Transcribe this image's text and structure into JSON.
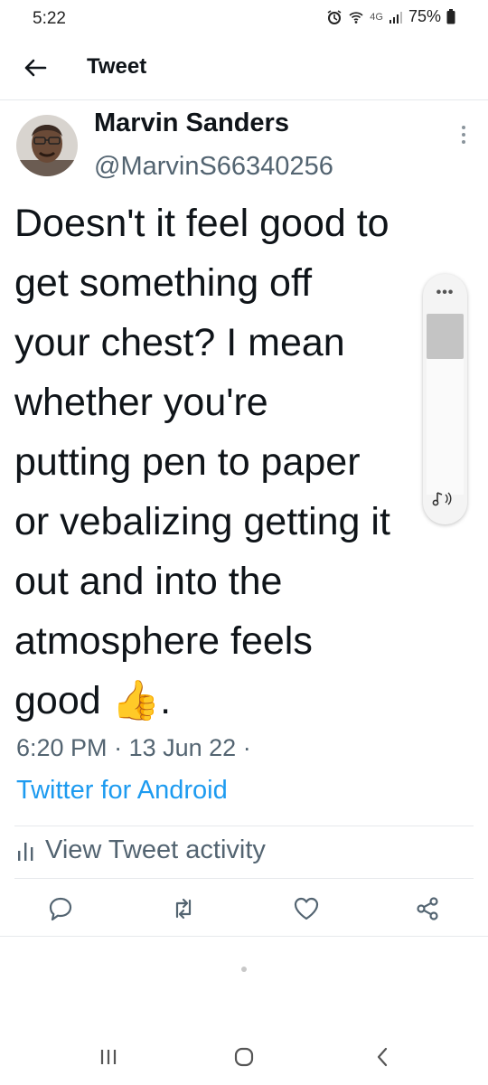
{
  "status_bar": {
    "time": "5:22",
    "network": "4G",
    "battery": "75%",
    "icons": [
      "alarm-icon",
      "wifi-icon",
      "signal-icon",
      "battery-icon"
    ]
  },
  "header": {
    "title": "Tweet",
    "back_icon": "arrow-left-icon"
  },
  "tweet": {
    "author_name": "Marvin Sanders",
    "author_handle": "@MarvinS66340256",
    "text_lines": [
      "Doesn't it feel good to",
      "get something off",
      "your chest? I mean",
      "whether you're",
      "putting pen to paper",
      "or vebalizing getting it",
      "out and into the",
      "atmosphere feels",
      "good 👍."
    ],
    "time": "6:20 PM",
    "date": "13 Jun 22",
    "separator": "·",
    "source": "Twitter for Android",
    "activity_label": "View Tweet activity"
  },
  "actions": [
    "reply-icon",
    "retweet-icon",
    "like-icon",
    "share-icon"
  ],
  "navigation": [
    "recents-icon",
    "home-icon",
    "back-icon"
  ],
  "colors": {
    "accent": "#1d9bf0",
    "text": "#0f1419",
    "secondary": "#536471",
    "divider": "#e6e9ec"
  }
}
